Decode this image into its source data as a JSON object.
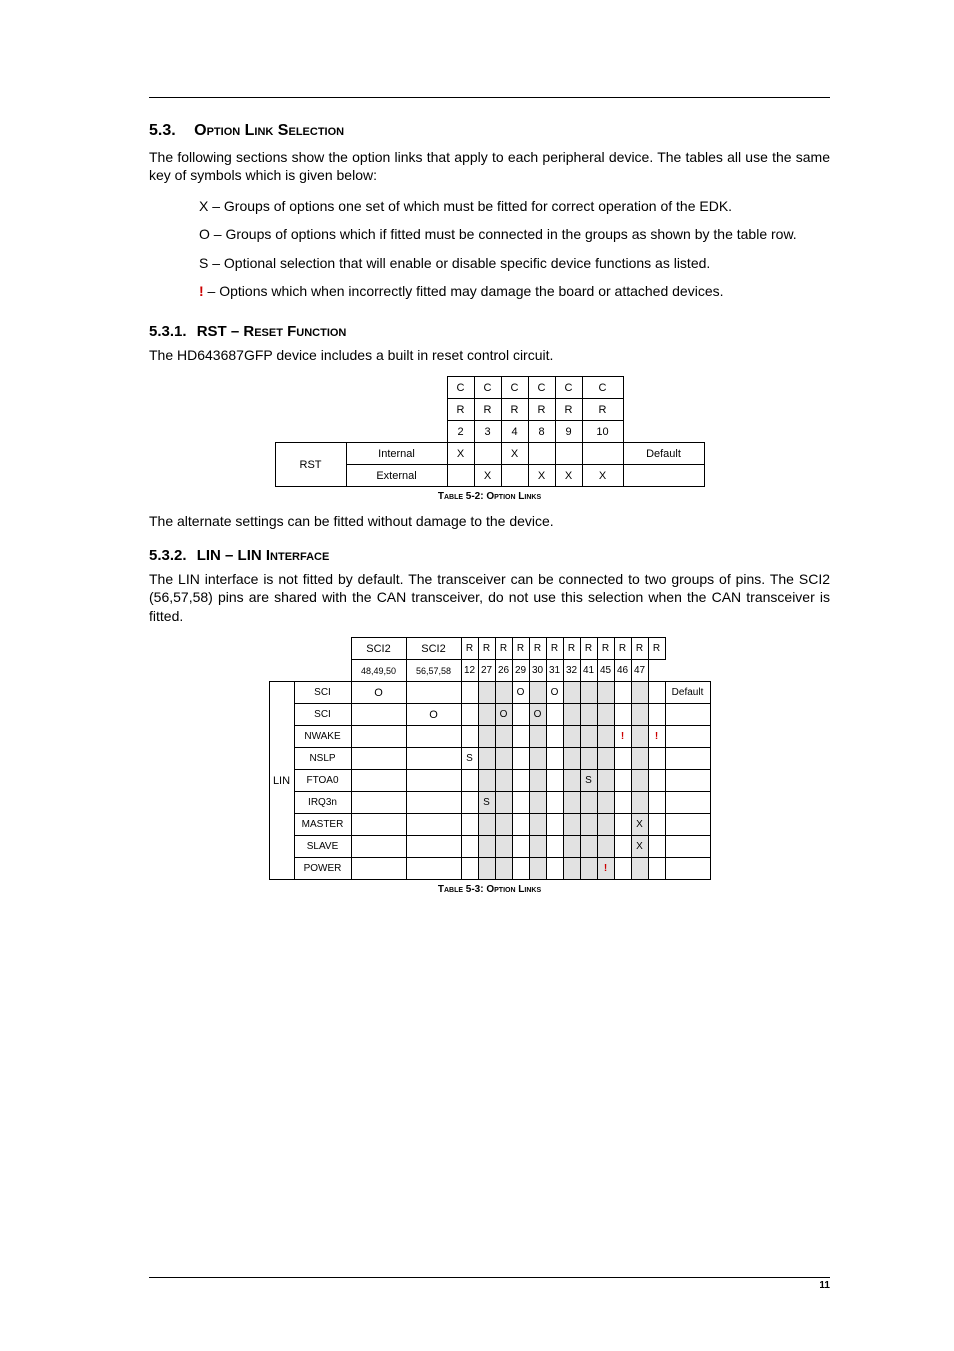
{
  "section53": {
    "num": "5.3.",
    "title": "Option Link Selection",
    "intro": "The following sections show the option links that apply to each peripheral device. The tables all use the same key of symbols which is given below:",
    "keys": {
      "x": "X – Groups of options one set of which must be fitted for correct operation of the EDK.",
      "o": "O – Groups of options which if fitted must be connected in the groups as shown by the table row.",
      "s": "S – Optional selection that will enable or disable specific device functions as listed.",
      "bang_sym": "!",
      "bang": " – Options which when incorrectly fitted may damage the board or attached devices."
    }
  },
  "section531": {
    "num": "5.3.1.",
    "title": "RST – Reset Function",
    "intro": "The HD643687GFP device includes a built in reset control circuit.",
    "table": {
      "head_top": [
        "C",
        "C",
        "C",
        "C",
        "C",
        "C"
      ],
      "head_mid": [
        "R",
        "R",
        "R",
        "R",
        "R",
        "R"
      ],
      "head_num": [
        "2",
        "3",
        "4",
        "8",
        "9",
        "10"
      ],
      "group": "RST",
      "rows": [
        {
          "label": "Internal",
          "cells": [
            "X",
            "",
            "X",
            "",
            "",
            ""
          ],
          "note": "Default"
        },
        {
          "label": "External",
          "cells": [
            "",
            "X",
            "",
            "X",
            "X",
            "X"
          ],
          "note": ""
        }
      ],
      "caption": "Table 5-2: Option Links"
    },
    "after": "The alternate settings can be fitted without damage to the device."
  },
  "section532": {
    "num": "5.3.2.",
    "title": "LIN – LIN Interface",
    "intro": "The LIN interface is not fitted by default. The transceiver can be connected to two groups of pins. The SCI2 (56,57,58) pins are shared with the CAN transceiver, do not use this selection when the CAN transceiver is fitted.",
    "table": {
      "head1": [
        "SCI2",
        "SCI2",
        "R",
        "R",
        "R",
        "R",
        "R",
        "R",
        "R",
        "R",
        "R",
        "R",
        "R",
        "R"
      ],
      "head2": [
        "48,49,50",
        "56,57,58",
        "12",
        "27",
        "26",
        "29",
        "30",
        "31",
        "32",
        "41",
        "45",
        "46",
        "47"
      ],
      "group": "LIN",
      "rows": [
        {
          "label": "SCI",
          "c": [
            "O",
            "",
            "",
            "",
            "",
            "O",
            "",
            "O",
            "",
            "",
            "",
            "",
            "",
            ""
          ],
          "note": "Default",
          "danger": []
        },
        {
          "label": "SCI",
          "c": [
            "",
            "O",
            "",
            "",
            "O",
            "",
            "O",
            "",
            "",
            "",
            "",
            "",
            "",
            ""
          ],
          "note": "",
          "danger": []
        },
        {
          "label": "NWAKE",
          "c": [
            "",
            "",
            "",
            "",
            "",
            "",
            "",
            "",
            "",
            "",
            "",
            "!",
            "",
            "!"
          ],
          "note": "",
          "danger": [
            11,
            13
          ]
        },
        {
          "label": "NSLP",
          "c": [
            "",
            "",
            "S",
            "",
            "",
            "",
            "",
            "",
            "",
            "",
            "",
            "",
            "",
            ""
          ],
          "note": "",
          "danger": []
        },
        {
          "label": "FTOA0",
          "c": [
            "",
            "",
            "",
            "",
            "",
            "",
            "",
            "",
            "",
            "S",
            "",
            "",
            "",
            ""
          ],
          "note": "",
          "danger": []
        },
        {
          "label": "IRQ3n",
          "c": [
            "",
            "",
            "",
            "S",
            "",
            "",
            "",
            "",
            "",
            "",
            "",
            "",
            "",
            ""
          ],
          "note": "",
          "danger": []
        },
        {
          "label": "MASTER",
          "c": [
            "",
            "",
            "",
            "",
            "",
            "",
            "",
            "",
            "",
            "",
            "",
            "",
            "X",
            ""
          ],
          "note": "",
          "danger": []
        },
        {
          "label": "SLAVE",
          "c": [
            "",
            "",
            "",
            "",
            "",
            "",
            "",
            "",
            "",
            "",
            "",
            "",
            "X",
            ""
          ],
          "note": "",
          "danger": []
        },
        {
          "label": "POWER",
          "c": [
            "",
            "",
            "",
            "",
            "",
            "",
            "",
            "",
            "",
            "",
            "!",
            "",
            "",
            ""
          ],
          "note": "",
          "danger": [
            10
          ]
        }
      ],
      "caption": "Table 5-3: Option Links"
    }
  },
  "page_number": "11"
}
